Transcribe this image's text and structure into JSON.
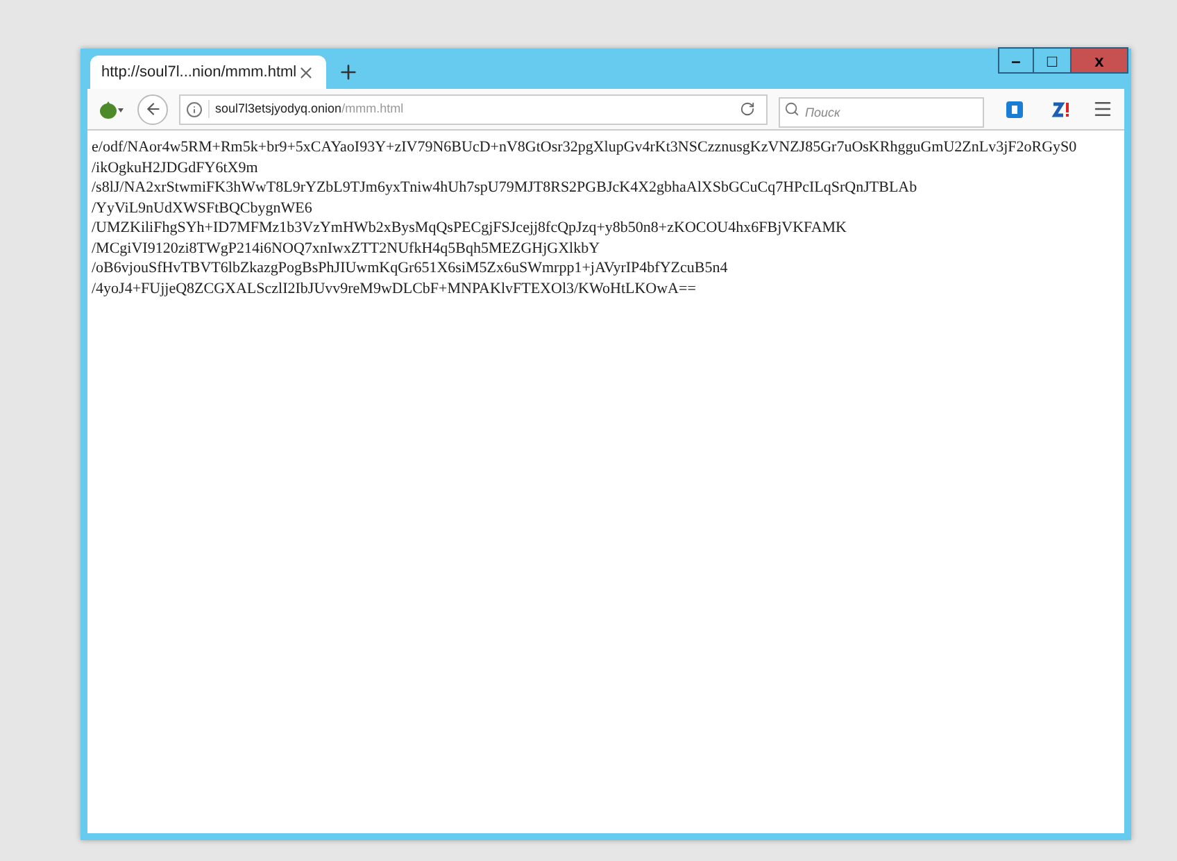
{
  "tab": {
    "title": "http://soul7l...nion/mmm.html",
    "selected": true
  },
  "window_controls": {
    "minimize": "–",
    "maximize": "□",
    "close": "x"
  },
  "address_bar": {
    "host": "soul7l3etsjyodyq.onion",
    "path": "/mmm.html"
  },
  "search": {
    "placeholder": "Поиск"
  },
  "page_lines": [
    "e/odf/NAor4w5RM+Rm5k+br9+5xCAYaoI93Y+zIV79N6BUcD+nV8GtOsr32pgXlupGv4rKt3NSCzznusgKzVNZJ85Gr7uOsKRhgguGmU2ZnLv3jF2oRGyS0",
    "/ikOgkuH2JDGdFY6tX9m",
    "/s8lJ/NA2xrStwmiFK3hWwT8L9rYZbL9TJm6yxTniw4hUh7spU79MJT8RS2PGBJcK4X2gbhaAlXSbGCuCq7HPcILqSrQnJTBLAb",
    "/YyViL9nUdXWSFtBQCbygnWE6",
    "/UMZKiliFhgSYh+ID7MFMz1b3VzYmHWb2xBysMqQsPECgjFSJcejj8fcQpJzq+y8b50n8+zKOCOU4hx6FBjVKFAMK",
    "/MCgiVI9120zi8TWgP214i6NOQ7xnIwxZTT2NUfkH4q5Bqh5MEZGHjGXlkbY",
    "/oB6vjouSfHvTBVT6lbZkazgPogBsPhJIUwmKqGr651X6siM5Zx6uSWmrpp1+jAVyrIP4bfYZcuB5n4",
    "/4yoJ4+FUjjeQ8ZCGXALSczlI2IbJUvv9reM9wDLCbF+MNPAKlvFTEXOl3/KWoHtLKOwA=="
  ]
}
